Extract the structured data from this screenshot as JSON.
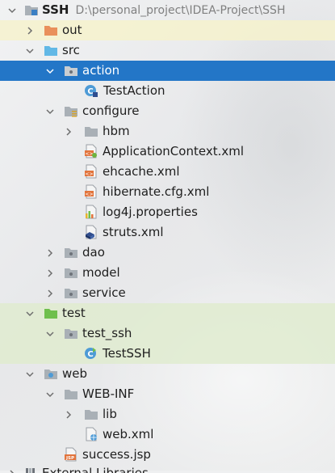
{
  "project": {
    "name": "SSH",
    "path": "D:\\personal_project\\IDEA-Project\\SSH"
  },
  "tree": {
    "out": "out",
    "src": "src",
    "action": "action",
    "test_action": "TestAction",
    "configure": "configure",
    "hbm": "hbm",
    "application_context": "ApplicationContext.xml",
    "ehcache": "ehcache.xml",
    "hibernate_cfg": "hibernate.cfg.xml",
    "log4j": "log4j.properties",
    "struts": "struts.xml",
    "dao": "dao",
    "model": "model",
    "service": "service",
    "test": "test",
    "test_ssh": "test_ssh",
    "test_ssh_class": "TestSSH",
    "web": "web",
    "web_inf": "WEB-INF",
    "lib": "lib",
    "web_xml": "web.xml",
    "success_jsp": "success.jsp",
    "external_libraries": "External Libraries"
  },
  "colors": {
    "selection": "#2376c7",
    "folder_grey": "#a9b0b6",
    "folder_orange": "#e9905b",
    "folder_blue": "#62b8e6",
    "folder_green": "#6fbf4d",
    "highlight_yellow": "#f6f3cb",
    "highlight_green": "#dfecce"
  }
}
